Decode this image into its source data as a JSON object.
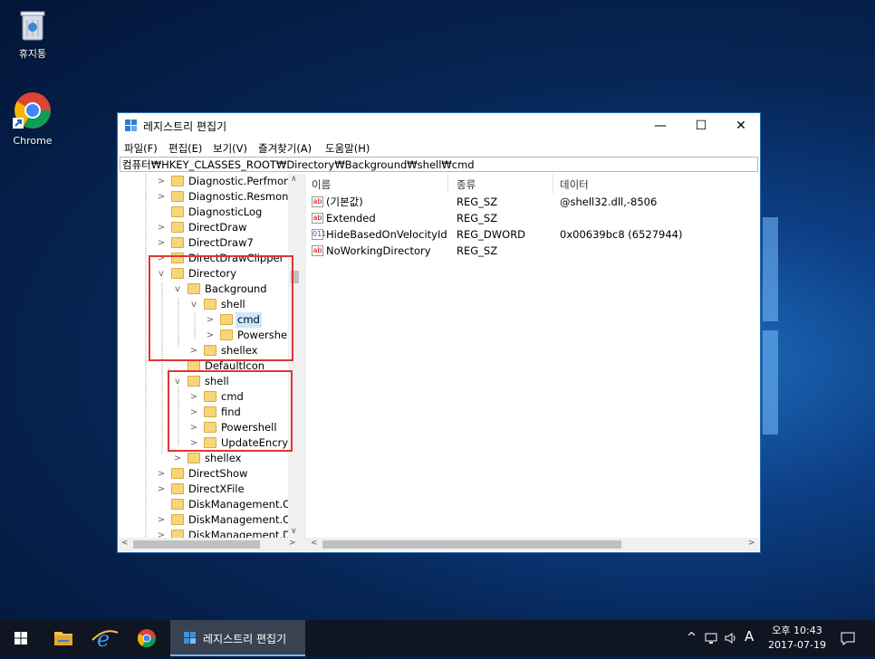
{
  "desktop": {
    "icons": [
      {
        "label": "휴지통"
      },
      {
        "label": "Chrome"
      }
    ]
  },
  "window": {
    "title": "레지스트리 편집기",
    "controls": {
      "minimize": "—",
      "maximize": "☐",
      "close": "✕"
    },
    "menu": [
      "파일(F)",
      "편집(E)",
      "보기(V)",
      "즐겨찾기(A)",
      "도움말(H)"
    ],
    "address": "컴퓨터₩HKEY_CLASSES_ROOT₩Directory₩Background₩shell₩cmd",
    "tree": [
      {
        "label": "Diagnostic.Perfmon.D"
      },
      {
        "label": "Diagnostic.Resmon.C"
      },
      {
        "label": "DiagnosticLog"
      },
      {
        "label": "DirectDraw"
      },
      {
        "label": "DirectDraw7"
      },
      {
        "label": "DirectDrawClipper"
      },
      {
        "label": "Directory"
      },
      {
        "label": "Background"
      },
      {
        "label": "shell"
      },
      {
        "label": "cmd"
      },
      {
        "label": "Powershell"
      },
      {
        "label": "shellex"
      },
      {
        "label": "DefaultIcon"
      },
      {
        "label": "shell"
      },
      {
        "label": "cmd"
      },
      {
        "label": "find"
      },
      {
        "label": "Powershell"
      },
      {
        "label": "UpdateEncrypt"
      },
      {
        "label": "shellex"
      },
      {
        "label": "DirectShow"
      },
      {
        "label": "DirectXFile"
      },
      {
        "label": "DiskManagement.Co"
      },
      {
        "label": "DiskManagement.Co"
      },
      {
        "label": "DiskManagement.Dat"
      }
    ],
    "list": {
      "columns": [
        "이름",
        "종류",
        "데이터"
      ],
      "rows": [
        {
          "icon": "ab",
          "name": "(기본값)",
          "type": "REG_SZ",
          "data": "@shell32.dll,-8506"
        },
        {
          "icon": "ab",
          "name": "Extended",
          "type": "REG_SZ",
          "data": ""
        },
        {
          "icon": "011",
          "name": "HideBasedOnVelocityId",
          "type": "REG_DWORD",
          "data": "0x00639bc8 (6527944)"
        },
        {
          "icon": "ab",
          "name": "NoWorkingDirectory",
          "type": "REG_SZ",
          "data": ""
        }
      ]
    }
  },
  "taskbar": {
    "active_app": "레지스트리 편집기",
    "clock": {
      "ampm_time": "오후 10:43",
      "date": "2017-07-19"
    },
    "ime": "A",
    "tray_chevron": "^"
  },
  "colors": {
    "highlight_box": "#e03535",
    "selected_item_bg": "#cce8ff",
    "taskbar_bg": "#101522"
  }
}
